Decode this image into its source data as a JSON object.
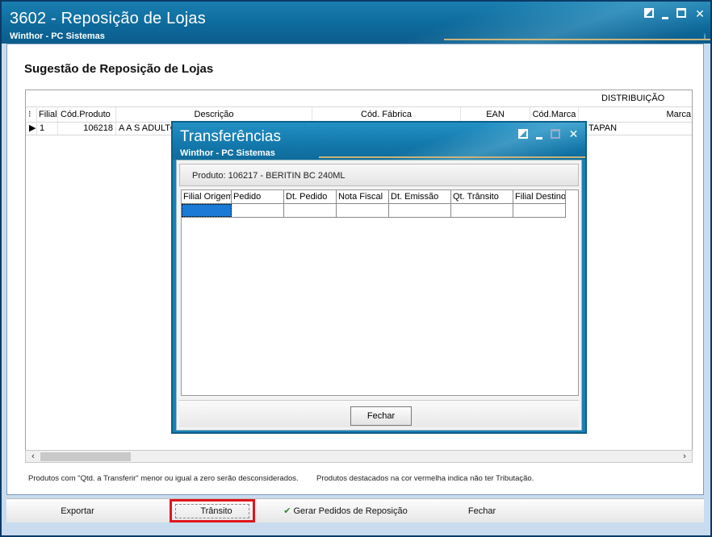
{
  "main": {
    "title": "3602 - Reposição de Lojas",
    "subtitle": "Winthor - PC Sistemas",
    "info_glyph": "i",
    "page_title": "Sugestão de Reposição de Lojas",
    "band_label": "DISTRIBUIÇÃO",
    "columns": [
      "Filial",
      "Cód.Produto",
      "Descrição",
      "Cód. Fábrica",
      "EAN",
      "Cód.Marca",
      "Marca"
    ],
    "rows": [
      {
        "filial": "1",
        "cod_produto": "106218",
        "descricao": "A A S ADULTO",
        "marca": "TAPAN"
      }
    ],
    "note_left": "Produtos com \"Qtd. a Transferir\" menor ou igual a zero serão desconsiderados.",
    "note_right": "Produtos destacados na cor vermelha indica não ter Tributação.",
    "buttons": {
      "exportar": "Exportar",
      "transito": "Trânsito",
      "gerar": "Gerar Pedidos de Reposição",
      "fechar": "Fechar"
    }
  },
  "dialog": {
    "title": "Transferências",
    "subtitle": "Winthor - PC Sistemas",
    "product": "Produto: 106217 - BERITIN BC 240ML",
    "columns": [
      "Filial Origem",
      "Pedido",
      "Dt. Pedido",
      "Nota Fiscal",
      "Dt. Emissão",
      "Qt. Trânsito",
      "Filial Destino"
    ],
    "fechar": "Fechar"
  },
  "colors": {
    "title_bar": "#0e6a9c",
    "highlight_border": "#e0161c",
    "selected_cell": "#1a7ad6"
  }
}
